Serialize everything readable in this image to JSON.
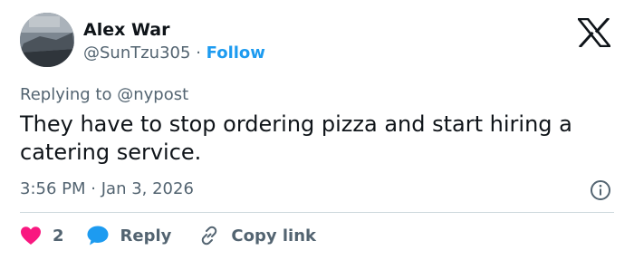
{
  "author": {
    "name": "Alex War",
    "handle": "@SunTzu305",
    "separator": "·",
    "follow_label": "Follow"
  },
  "reply_context": {
    "prefix": "Replying to",
    "mention": "@nypost"
  },
  "tweet": {
    "text": "They have to stop ordering pizza and start hiring a catering service.",
    "time": "3:56 PM",
    "separator": "·",
    "date": "Jan 3, 2026"
  },
  "actions": {
    "like_count": "2",
    "reply_label": "Reply",
    "copy_label": "Copy link"
  },
  "icons": {
    "brand": "x-logo-icon",
    "info": "info-icon",
    "like": "heart-icon",
    "reply": "speech-bubble-icon",
    "copy": "link-icon"
  },
  "colors": {
    "text_primary": "#0f1419",
    "text_secondary": "#536471",
    "accent": "#1d9bf0",
    "like": "#f91880",
    "divider": "#cfd9de"
  }
}
